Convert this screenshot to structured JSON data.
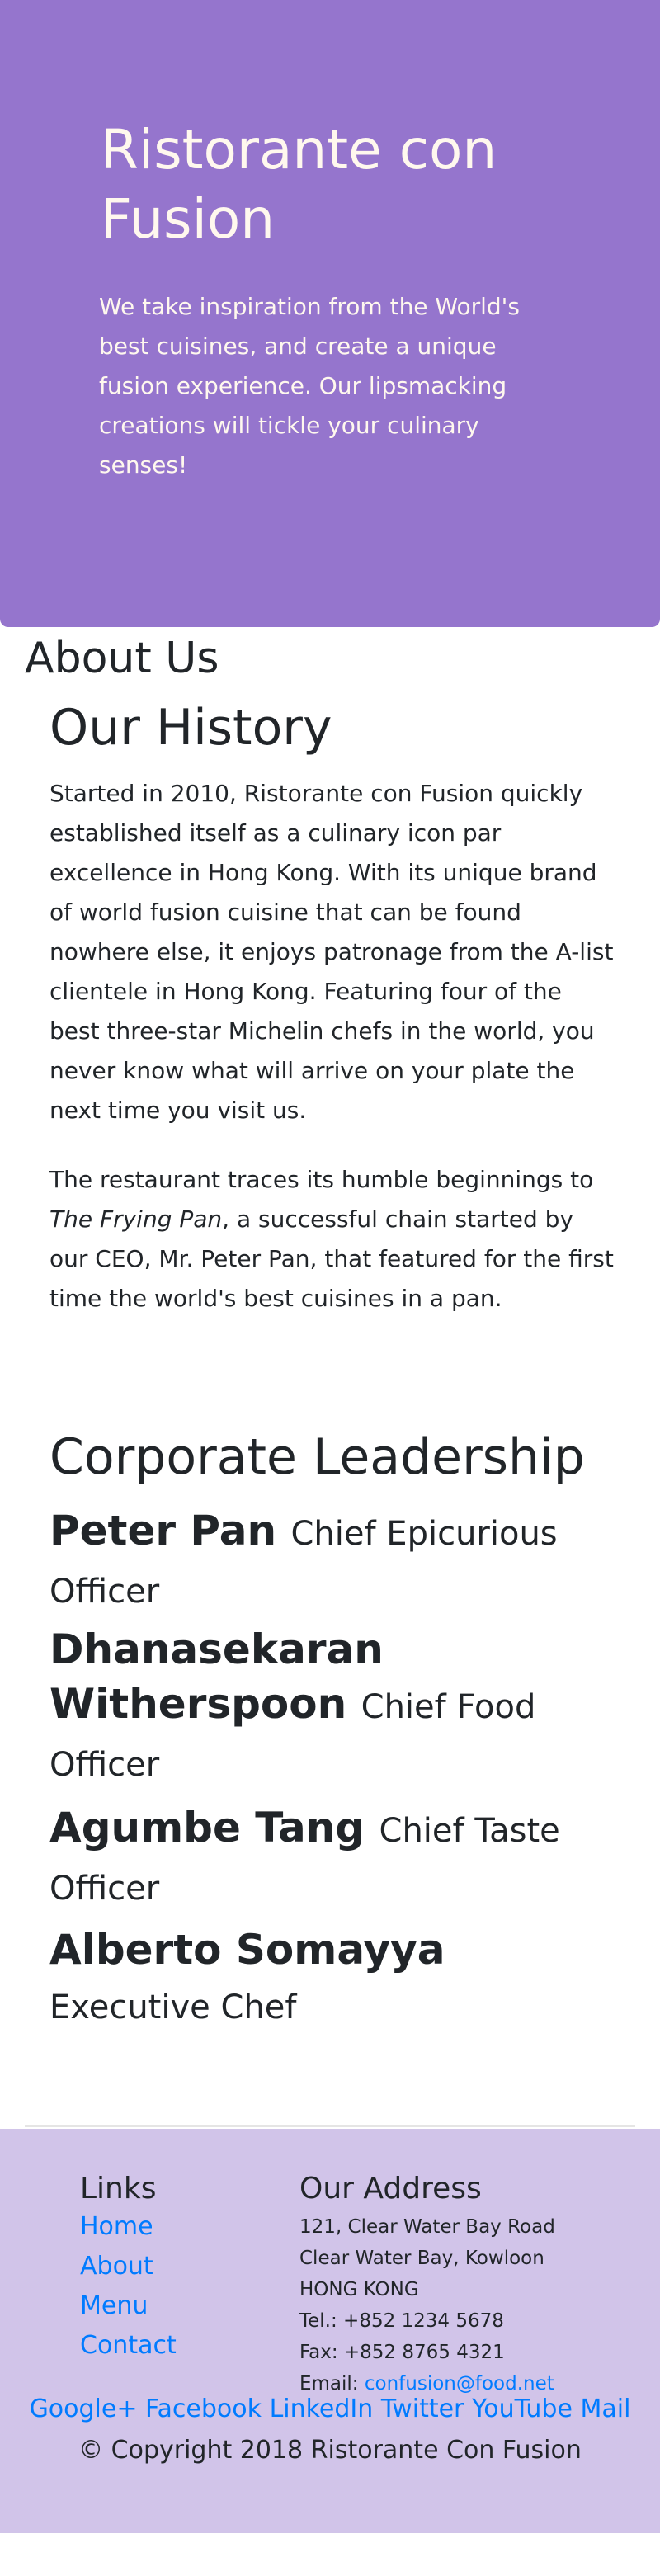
{
  "colors": {
    "jumbotron": "#9575cd",
    "footer": "#d1c4e9",
    "link": "#007bff"
  },
  "jumbotron": {
    "title": "Ristorante con Fusion",
    "text": "We take inspiration from the World's best cuisines, and create a unique fusion experience. Our lipsmacking creations will tickle your culinary senses!"
  },
  "about": {
    "heading": "About Us",
    "history_heading": "Our History",
    "p1": "Started in 2010, Ristorante con Fusion quickly established itself as a culinary icon par excellence in Hong Kong. With its unique brand of world fusion cuisine that can be found nowhere else, it enjoys patronage from the A-list clientele in Hong Kong. Featuring four of the best three-star Michelin chefs in the world, you never know what will arrive on your plate the next time you visit us.",
    "p2_pre": "The restaurant traces its humble beginnings to ",
    "p2_em": "The Frying Pan",
    "p2_post": ", a successful chain started by our CEO, Mr. Peter Pan, that featured for the first time the world's best cuisines in a pan."
  },
  "leadership": {
    "heading": "Corporate Leadership",
    "leaders": [
      {
        "name": "Peter Pan",
        "title": "Chief Epicurious Officer"
      },
      {
        "name": "Dhanasekaran Witherspoon",
        "title": "Chief Food Officer"
      },
      {
        "name": "Agumbe Tang",
        "title": "Chief Taste Officer"
      },
      {
        "name": "Alberto Somayya",
        "title": "Executive Chef"
      }
    ]
  },
  "footer": {
    "links_heading": "Links",
    "links": [
      "Home",
      "About",
      "Menu",
      "Contact"
    ],
    "address_heading": "Our Address",
    "address": [
      "121, Clear Water Bay Road",
      "Clear Water Bay, Kowloon",
      "HONG KONG",
      "Tel.: +852 1234 5678",
      "Fax: +852 8765 4321"
    ],
    "email_label": "Email: ",
    "email": "confusion@food.net",
    "social": [
      "Google+",
      "Facebook",
      "LinkedIn",
      "Twitter",
      "YouTube",
      "Mail"
    ],
    "copyright": "© Copyright 2018 Ristorante Con Fusion"
  }
}
